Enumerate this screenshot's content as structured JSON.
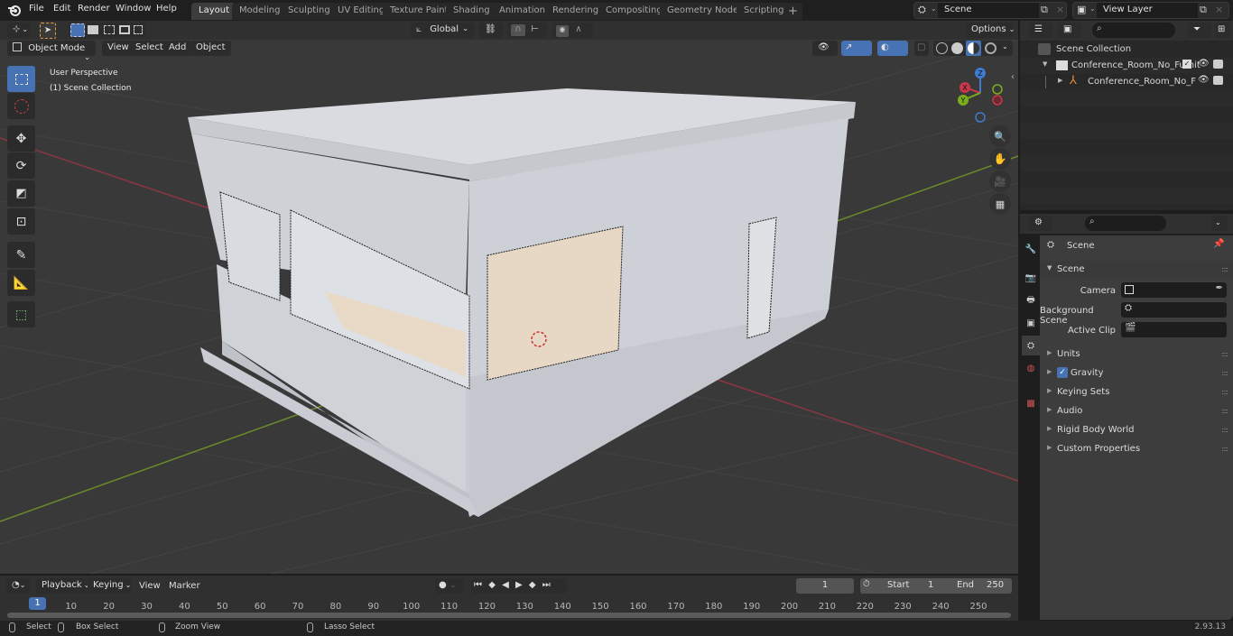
{
  "app": {
    "version": "2.93.13"
  },
  "menu": [
    "File",
    "Edit",
    "Render",
    "Window",
    "Help"
  ],
  "workspaces": [
    {
      "label": "Layout",
      "active": true
    },
    {
      "label": "Modeling"
    },
    {
      "label": "Sculpting"
    },
    {
      "label": "UV Editing"
    },
    {
      "label": "Texture Paint"
    },
    {
      "label": "Shading"
    },
    {
      "label": "Animation"
    },
    {
      "label": "Rendering"
    },
    {
      "label": "Compositing"
    },
    {
      "label": "Geometry Nodes"
    },
    {
      "label": "Scripting"
    }
  ],
  "scene_selector": {
    "value": "Scene"
  },
  "view_layer_selector": {
    "value": "View Layer"
  },
  "viewport": {
    "mode": "Object Mode",
    "menus": [
      "View",
      "Select",
      "Add",
      "Object"
    ],
    "transform_orientation": "Global",
    "options_label": "Options",
    "overlay_text": [
      "User Perspective",
      "(1) Scene Collection"
    ],
    "gizmo_axes": [
      "X",
      "Y",
      "Z"
    ],
    "tools": [
      "select-box",
      "cursor",
      "move",
      "rotate",
      "scale",
      "transform",
      "annotate",
      "measure",
      "add-cube"
    ],
    "colors": {
      "background": "#393939",
      "x_axis": "#9a3a44",
      "y_axis": "#6b8e23",
      "accent": "#4772b3"
    }
  },
  "outliner": {
    "root": "Scene Collection",
    "items": [
      {
        "label": "Conference_Room_No_Furnit",
        "type": "collection",
        "checked": true
      },
      {
        "label": "Conference_Room_No_F",
        "type": "empty"
      }
    ]
  },
  "properties": {
    "context": "Scene",
    "panel_title": "Scene",
    "fields": [
      {
        "label": "Camera",
        "value": ""
      },
      {
        "label": "Background Scene",
        "value": ""
      },
      {
        "label": "Active Clip",
        "value": ""
      }
    ],
    "subpanels": [
      "Units",
      "Gravity",
      "Keying Sets",
      "Audio",
      "Rigid Body World",
      "Custom Properties"
    ],
    "gravity_checked": true
  },
  "timeline": {
    "menus": [
      "Playback",
      "Keying",
      "View",
      "Marker"
    ],
    "current_frame": "1",
    "start_label": "Start",
    "start": "1",
    "end_label": "End",
    "end": "250",
    "ticks": [
      "10",
      "20",
      "30",
      "40",
      "50",
      "60",
      "70",
      "80",
      "90",
      "100",
      "110",
      "120",
      "130",
      "140",
      "150",
      "160",
      "170",
      "180",
      "190",
      "200",
      "210",
      "220",
      "230",
      "240",
      "250"
    ],
    "playhead": "1"
  },
  "statusbar": {
    "hints": [
      "Select",
      "Box Select",
      "Zoom View",
      "Lasso Select"
    ]
  }
}
